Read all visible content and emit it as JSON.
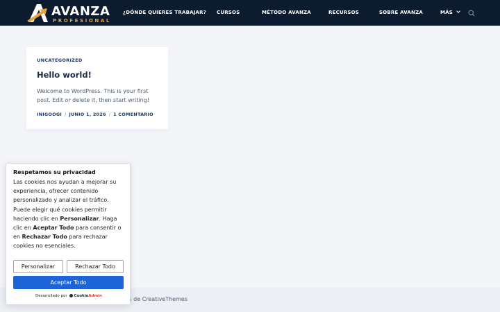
{
  "header": {
    "logo": {
      "name": "AVANZA",
      "tagline": "PROFESIONAL"
    },
    "nav": [
      {
        "label": "¿DÓNDE QUIERES TRABAJAR?"
      },
      {
        "label": "CURSOS"
      },
      {
        "label": "MÉTODO AVANZA"
      },
      {
        "label": "RECURSOS"
      },
      {
        "label": "SOBRE AVANZA"
      },
      {
        "label": "MÁS"
      }
    ],
    "icons": {
      "more": "chevron-down-icon",
      "search": "search-icon"
    }
  },
  "post": {
    "category": "UNCATEGORIZED",
    "title": "Hello world!",
    "excerpt": "Welcome to WordPress. This is your first post. Edit or delete it, then start writing!",
    "meta": {
      "author": "INIGOOGI",
      "date": "JUNIO 1, 2026",
      "comments": "1 COMENTARIO"
    }
  },
  "footer": {
    "text": "ss de CreativeThemes"
  },
  "cookie_banner": {
    "title": "Respetamos su privacidad",
    "body_1": "Las cookies nos ayudan a mejorar su experiencia, ofrecer contenido personalizado y analizar el tráfico. Puede elegir qué cookies permitir haciendo clic en ",
    "body_bold_1": "Personalizar",
    "body_2": ". Haga clic en ",
    "body_bold_2": "Aceptar Todo",
    "body_3": " para consentir o en ",
    "body_bold_3": "Rechazar Todo",
    "body_4": " para rechazar cookies no esenciales.",
    "buttons": {
      "customize": "Personalizar",
      "reject": "Rechazar Todo",
      "accept": "Aceptar Todo"
    },
    "powered_by": "Desarrollado por",
    "brand": {
      "part1": "Cookie",
      "part2": "Admin"
    },
    "colors": {
      "accept": "#1d64d8"
    }
  },
  "colors": {
    "header_bg": "#0d1b2e",
    "logo_accent": "#e8a33c",
    "page_bg": "#f3f5f8"
  }
}
